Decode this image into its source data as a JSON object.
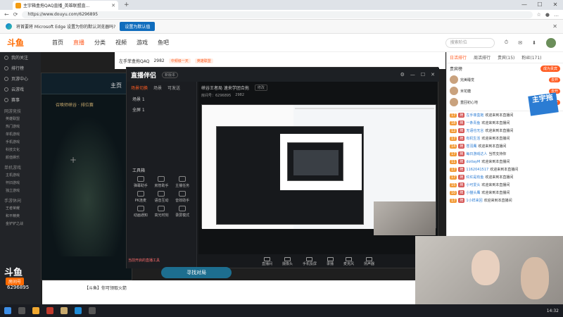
{
  "browser": {
    "tab_title": "主宇箱盒拖QAQ直播_英雄联盟直...",
    "url": "https://www.douyu.com/6296895",
    "infobar_msg": "将首要将 Microsoft Edge 设置为你的默认浏览器吗?",
    "infobar_btn": "设置为默认值"
  },
  "douyu": {
    "logo": "斗鱼",
    "nav": [
      "首页",
      "直播",
      "分类",
      "视频",
      "游戏",
      "鱼吧"
    ],
    "search_placeholder": "搜索阶位",
    "room_title": "左手菲盒拖QAQ",
    "room_id": "2982",
    "room_tag": "中频级一天",
    "room_category": "英雄联盟"
  },
  "sidebar": {
    "items": [
      "我的关注",
      "排行榜",
      "页游中心",
      "云游戏",
      "赛事"
    ],
    "section1": "网游竞技",
    "sub1": [
      "英雄联盟",
      "热门游戏",
      "单机游戏",
      "手机游戏",
      "科技文化",
      "颜值娱乐"
    ],
    "section2": "单机游戏",
    "sub2": [
      "主机游戏",
      "怀旧游戏",
      "独立游戏"
    ],
    "section3": "手游休闲",
    "sub3": [
      "王者荣耀",
      "和平精英",
      "金铲铲之战"
    ],
    "logo": "斗鱼",
    "room_label": "房间号",
    "room_no": "6296895"
  },
  "lol": {
    "home": "主页",
    "sub": "召唤师峡谷 · 排位赛"
  },
  "obs": {
    "brand": "直播伴侣",
    "version": "新版本",
    "tabs": [
      "场景切换",
      "场景",
      "可发送"
    ],
    "scenes": [
      "场景 1",
      "全屏 1"
    ],
    "tools_header": "工具箱",
    "tools": [
      "弹幕助手",
      "房管助手",
      "主播任务",
      "PK连麦",
      "语音互动",
      "音效助手",
      "动画通知",
      "高光时刻",
      "录屏模式"
    ],
    "footer": "当前开启的直播工具",
    "room_info": "峡谷王者局 速来学团合拖",
    "room_pill": "修改",
    "room_id_label": "房间号：6296895",
    "fans": "2982",
    "controls": [
      "直播间",
      "摄像头",
      "手机投屏",
      "录播",
      "麦克风",
      "扬声器"
    ],
    "start": "寻找对局"
  },
  "chat": {
    "tabs": [
      "日活排行",
      "周活排行",
      "贵宾(15)",
      "粉丝(171)"
    ],
    "section": "贵宾榜",
    "subscribe_btn": "成为贵宾",
    "ranks": [
      {
        "name": "完美睡觉",
        "badge": "去开"
      },
      {
        "name": "米花糖",
        "badge": "去开"
      },
      {
        "name": "重回初心地",
        "badge": "去开"
      }
    ],
    "messages": [
      {
        "lv": "17",
        "user": "左手菲盒拖",
        "text": "欢迎来到本直播间"
      },
      {
        "lv": "18",
        "user": "一条青鱼",
        "text": "欢迎来到本直播间"
      },
      {
        "lv": "12",
        "user": "无语也无言",
        "text": "欢迎来到本直播间"
      },
      {
        "lv": "17",
        "user": "有机生活",
        "text": "欢迎来到本直播间"
      },
      {
        "lv": "14",
        "user": "苍羽鹰",
        "text": "欢迎来到本直播间"
      },
      {
        "lv": "17",
        "user": "每日游戏达人",
        "text": "当然支持你"
      },
      {
        "lv": "11",
        "user": "dotlayM",
        "text": "欢迎来到本直播间"
      },
      {
        "lv": "17",
        "user": "1162041517",
        "text": "欢迎来到本直播间"
      },
      {
        "lv": "17",
        "user": "红红是有鱼",
        "text": "欢迎来到本直播间"
      },
      {
        "lv": "15",
        "user": "小可爱头",
        "text": "欢迎来到本直播间"
      },
      {
        "lv": "10",
        "user": "小猫头鹰",
        "text": "欢迎来到本直播间"
      },
      {
        "lv": "17",
        "user": "1小样来回",
        "text": "欢迎来到本直播间"
      }
    ],
    "brand_logo": "主宇拖"
  },
  "bottom": {
    "notice": "【斗鱼】你可领取火箭"
  },
  "taskbar": {
    "clock": "14:32"
  }
}
